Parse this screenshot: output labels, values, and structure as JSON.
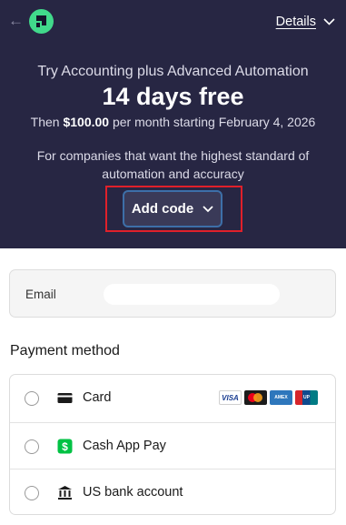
{
  "header": {
    "back_icon": "arrow-left-icon",
    "logo_icon": "brand-logo-icon",
    "details_label": "Details",
    "details_icon": "chevron-down-icon"
  },
  "offer": {
    "subtitle": "Try Accounting plus Advanced Automation",
    "headline": "14 days free",
    "price_prefix": "Then",
    "price": "$100.00",
    "price_suffix": "per month starting February 4, 2026",
    "description": "For companies that want the highest standard of automation and accuracy",
    "add_code_label": "Add code",
    "add_code_icon": "chevron-down-icon"
  },
  "email": {
    "label": "Email",
    "value": ""
  },
  "payment": {
    "title": "Payment method",
    "methods": [
      {
        "label": "Card",
        "icon": "credit-card-icon",
        "brands": [
          "VISA",
          "Mastercard",
          "AMERICAN EXPRESS",
          "UnionPay"
        ]
      },
      {
        "label": "Cash App Pay",
        "icon": "cash-app-icon"
      },
      {
        "label": "US bank account",
        "icon": "bank-icon"
      }
    ]
  },
  "colors": {
    "hero_bg": "#272643",
    "brand_green": "#41d98b",
    "cash_app_green": "#00c244",
    "highlight_red": "#e0202a",
    "button_bg": "#3a3a58",
    "button_border": "#3d6fa8"
  }
}
